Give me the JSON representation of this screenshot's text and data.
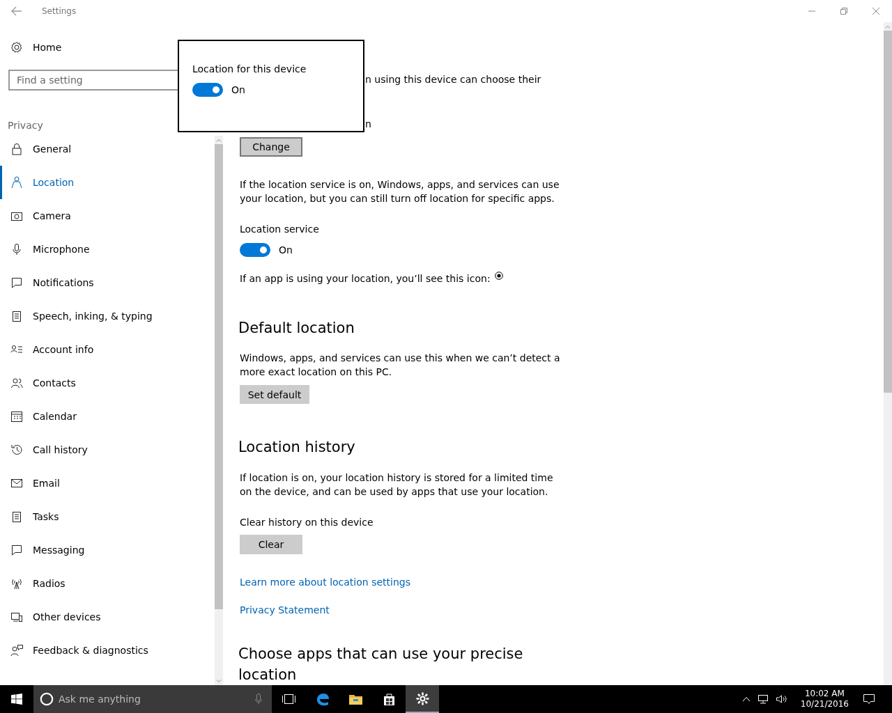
{
  "window": {
    "title": "Settings"
  },
  "sidebar": {
    "home": "Home",
    "search": {
      "placeholder": "Find a setting"
    },
    "section": "Privacy",
    "items": [
      {
        "label": "General",
        "selected": false
      },
      {
        "label": "Location",
        "selected": true
      },
      {
        "label": "Camera",
        "selected": false
      },
      {
        "label": "Microphone",
        "selected": false
      },
      {
        "label": "Notifications",
        "selected": false
      },
      {
        "label": "Speech, inking, & typing",
        "selected": false
      },
      {
        "label": "Account info",
        "selected": false
      },
      {
        "label": "Contacts",
        "selected": false
      },
      {
        "label": "Calendar",
        "selected": false
      },
      {
        "label": "Call history",
        "selected": false
      },
      {
        "label": "Email",
        "selected": false
      },
      {
        "label": "Tasks",
        "selected": false
      },
      {
        "label": "Messaging",
        "selected": false
      },
      {
        "label": "Radios",
        "selected": false
      },
      {
        "label": "Other devices",
        "selected": false
      },
      {
        "label": "Feedback & diagnostics",
        "selected": false
      }
    ]
  },
  "main": {
    "partial_text": [
      "n using this device can choose their",
      "n"
    ],
    "change_button": "Change",
    "service_description": "If the location service is on, Windows, apps, and services can use your location, but you can still turn off location for specific apps.",
    "service_toggle": {
      "label": "Location service",
      "on": true,
      "state_text": "On"
    },
    "icon_note": "If an app is using your location, you’ll see this icon:",
    "default_location": {
      "heading": "Default location",
      "text": "Windows, apps, and services can use this when we can’t detect a more exact location on this PC.",
      "button": "Set default"
    },
    "location_history": {
      "heading": "Location history",
      "text": "If location is on, your location history is stored for a limited time on the device, and can be used by apps that use your location.",
      "clear_label": "Clear history on this device",
      "button": "Clear"
    },
    "links": [
      "Learn more about location settings",
      "Privacy Statement"
    ],
    "apps_heading": "Choose apps that can use your precise location"
  },
  "popup": {
    "label": "Location for this device",
    "on": true,
    "state_text": "On"
  },
  "taskbar": {
    "search_placeholder": "Ask me anything",
    "apps": [
      {
        "kind": "taskview",
        "selected": false
      },
      {
        "kind": "browser",
        "selected": false
      },
      {
        "kind": "folder",
        "selected": false
      },
      {
        "kind": "store",
        "selected": false
      },
      {
        "kind": "settings",
        "selected": true
      }
    ],
    "clock": {
      "time": "10:02 AM",
      "date": "10/21/2016"
    }
  }
}
